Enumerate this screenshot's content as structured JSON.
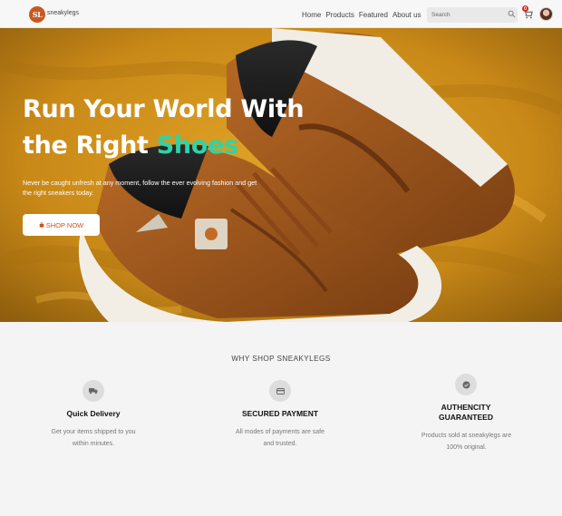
{
  "navbar": {
    "logo_text": "SL",
    "brand": "sneakylegs",
    "links": [
      "Home",
      "Products",
      "Featured",
      "About us"
    ],
    "search_placeholder": "Search",
    "cart_count": "0"
  },
  "hero": {
    "title_line1": "Run Your World With",
    "title_line2_start": "the Right ",
    "title_accent": "Shoes",
    "subtitle": "Never be caught unfresh at any moment, follow the ever evolving fashion and get the right sneakers today.",
    "button_label": "SHOP NOW",
    "accent_color": "#2fd3a7"
  },
  "why": {
    "heading": "WHY SHOP SNEAKYLEGS",
    "features": [
      {
        "icon": "truck-icon",
        "title": "Quick Delivery",
        "desc": "Get your items shipped to you within minutes."
      },
      {
        "icon": "credit-card-icon",
        "title": "SECURED PAYMENT",
        "desc": "All modes of payments are safe and trusted."
      },
      {
        "icon": "check-badge-icon",
        "title": "AUTHENCITY GUARANTEED",
        "desc": "Products sold at sneakylegs are 100% original."
      }
    ]
  }
}
